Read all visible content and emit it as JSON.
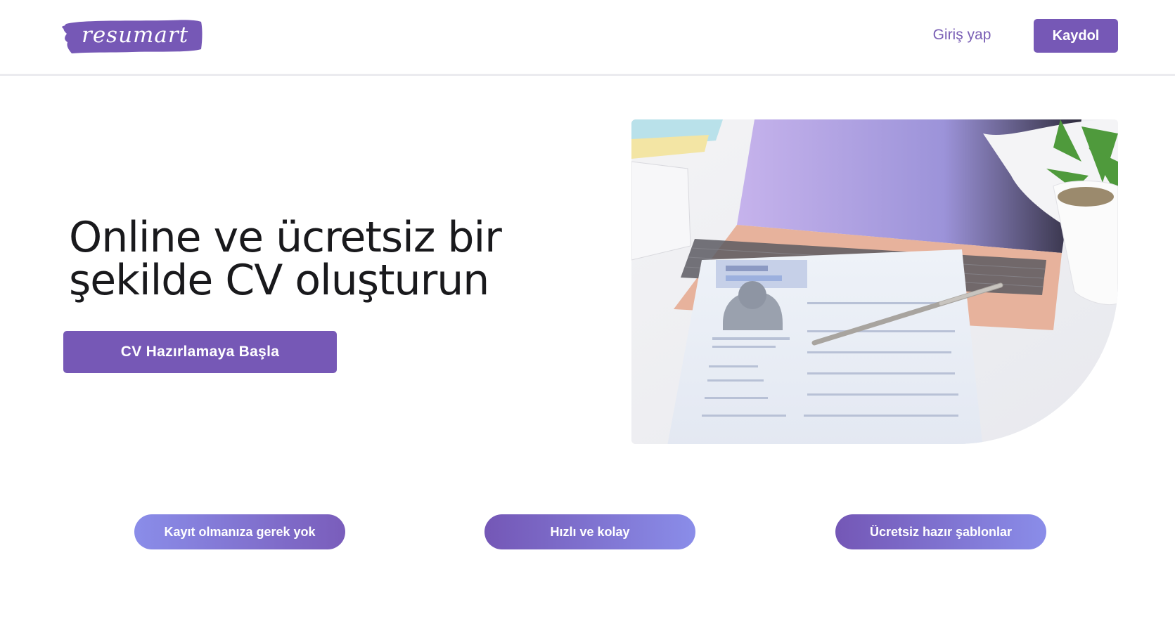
{
  "header": {
    "logo_text": "resumart",
    "login_label": "Giriş yap",
    "signup_label": "Kaydol"
  },
  "hero": {
    "title_line1": "Online ve ücretsiz bir",
    "title_line2": "şekilde CV oluşturun",
    "cta_label": "CV Hazırlamaya Başla"
  },
  "features": [
    {
      "label": "Kayıt olmanıza gerek yok"
    },
    {
      "label": "Hızlı ve kolay"
    },
    {
      "label": "Ücretsiz hazır şablonlar"
    }
  ],
  "colors": {
    "brand": "#7658b6",
    "pill_light": "#8a8de9"
  },
  "icons": {
    "logo": "brush-stroke-logo"
  }
}
